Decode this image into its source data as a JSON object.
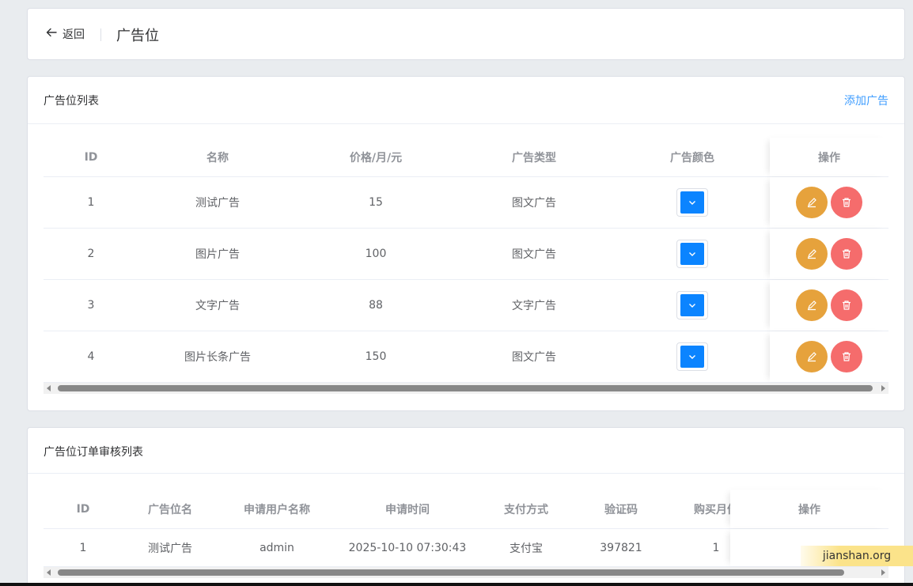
{
  "header": {
    "back_label": "返回",
    "title": "广告位"
  },
  "slots": {
    "title": "广告位列表",
    "add_label": "添加广告",
    "columns": [
      "ID",
      "名称",
      "价格/月/元",
      "广告类型",
      "广告颜色",
      "操作"
    ],
    "rows": [
      {
        "id": "1",
        "name": "测试广告",
        "price": "15",
        "type": "图文广告",
        "color": "#0b84ff"
      },
      {
        "id": "2",
        "name": "图片广告",
        "price": "100",
        "type": "图文广告",
        "color": "#0b84ff"
      },
      {
        "id": "3",
        "name": "文字广告",
        "price": "88",
        "type": "文字广告",
        "color": "#0b84ff"
      },
      {
        "id": "4",
        "name": "图片长条广告",
        "price": "150",
        "type": "图文广告",
        "color": "#0b84ff"
      }
    ]
  },
  "orders": {
    "title": "广告位订单审核列表",
    "columns": [
      "ID",
      "广告位名",
      "申请用户名称",
      "申请时间",
      "支付方式",
      "验证码",
      "购买月份",
      "操作"
    ],
    "rows": [
      {
        "id": "1",
        "slot": "测试广告",
        "user": "admin",
        "time": "2025-10-10 07:30:43",
        "payment": "支付宝",
        "code": "397821",
        "months": "1"
      }
    ]
  },
  "watermark": "jianshan.org",
  "colors": {
    "accent": "#409eff",
    "edit": "#e6a23c",
    "delete": "#f56c6c",
    "swatch": "#0b84ff"
  },
  "icons": [
    "back-arrow-icon",
    "chevron-down-icon",
    "edit-icon",
    "trash-icon",
    "scroll-left-icon",
    "scroll-right-icon"
  ]
}
